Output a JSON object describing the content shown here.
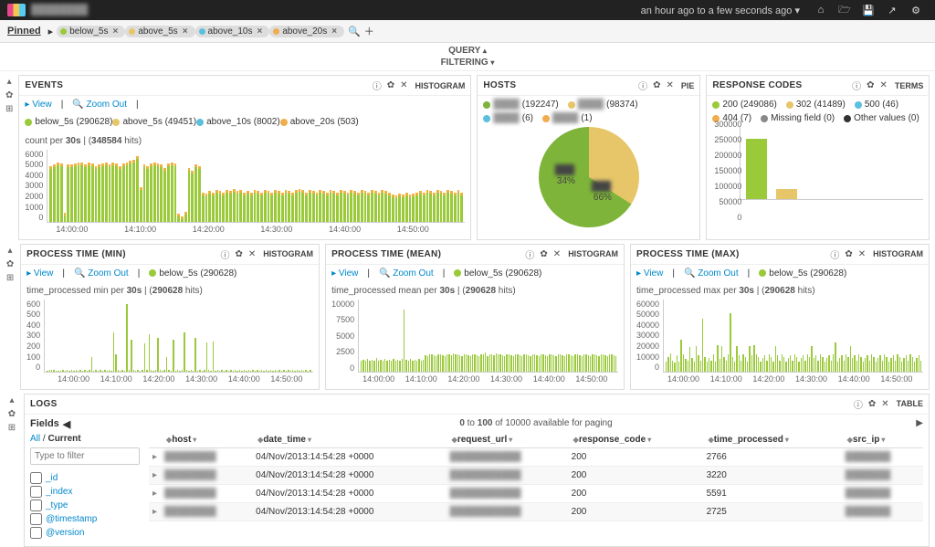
{
  "nav": {
    "timerange": "an hour ago to a few seconds ago",
    "timerange_caret": "▾"
  },
  "pinned": {
    "label": "Pinned",
    "search_icon_title": "search",
    "plus_icon_title": "add",
    "tags": [
      {
        "label": "below_5s",
        "color": "#9ac93a"
      },
      {
        "label": "above_5s",
        "color": "#e7c66a"
      },
      {
        "label": "above_10s",
        "color": "#5bc0de"
      },
      {
        "label": "above_20s",
        "color": "#f0ad4e"
      }
    ]
  },
  "qbar": {
    "query": "QUERY",
    "filtering": "FILTERING",
    "caret_up": "▴",
    "caret_down": "▾"
  },
  "row_icons": {
    "collapse": "▴",
    "gear": "✿",
    "add": "⊞"
  },
  "panel_events": {
    "title": "EVENTS",
    "type": "HISTOGRAM",
    "view": "View",
    "zoom": "Zoom Out",
    "legend": [
      {
        "label": "below_5s (290628)",
        "color": "#9ac93a"
      },
      {
        "label": "above_5s (49451)",
        "color": "#e7c66a"
      },
      {
        "label": "above_10s (8002)",
        "color": "#5bc0de"
      },
      {
        "label": "above_20s (503)",
        "color": "#f0ad4e"
      }
    ],
    "caption_a": "count per ",
    "caption_bold": "30s",
    "caption_b": " | (",
    "caption_c": "348584",
    "caption_d": " hits)"
  },
  "panel_hosts": {
    "title": "HOSTS",
    "type": "PIE",
    "items": [
      {
        "count": "(192247)",
        "color": "#7eb43a"
      },
      {
        "count": "(98374)",
        "color": "#e7c66a"
      },
      {
        "count": "(6)",
        "color": "#5bc0de"
      },
      {
        "count": "(1)",
        "color": "#f0ad4e"
      }
    ],
    "slice_a": "34%",
    "slice_b": "66%"
  },
  "panel_codes": {
    "title": "RESPONSE CODES",
    "type": "TERMS",
    "items": [
      {
        "label": "200 (249086)",
        "color": "#9ac93a"
      },
      {
        "label": "302 (41489)",
        "color": "#e7c66a"
      },
      {
        "label": "500 (46)",
        "color": "#5bc0de"
      },
      {
        "label": "404 (7)",
        "color": "#f0ad4e"
      },
      {
        "label": "Missing field (0)",
        "color": "#888"
      },
      {
        "label": "Other values (0)",
        "color": "#333"
      }
    ]
  },
  "panel_pt_min": {
    "title": "PROCESS TIME (MIN)",
    "type": "HISTOGRAM",
    "view": "View",
    "zoom": "Zoom Out",
    "legend_label": "below_5s (290628)",
    "legend_color": "#9ac93a",
    "caption_a": "time_processed min per ",
    "caption_bold": "30s",
    "caption_b": " | (",
    "caption_c": "290628",
    "caption_d": " hits)"
  },
  "panel_pt_mean": {
    "title": "PROCESS TIME (MEAN)",
    "type": "HISTOGRAM",
    "view": "View",
    "zoom": "Zoom Out",
    "legend_label": "below_5s (290628)",
    "legend_color": "#9ac93a",
    "caption_a": "time_processed mean per ",
    "caption_bold": "30s",
    "caption_b": " | (",
    "caption_c": "290628",
    "caption_d": " hits)"
  },
  "panel_pt_max": {
    "title": "PROCESS TIME (MAX)",
    "type": "HISTOGRAM",
    "view": "View",
    "zoom": "Zoom Out",
    "legend_label": "below_5s (290628)",
    "legend_color": "#9ac93a",
    "caption_a": "time_processed max per ",
    "caption_bold": "30s",
    "caption_b": " | (",
    "caption_c": "290628",
    "caption_d": " hits)"
  },
  "panel_logs": {
    "title": "LOGS",
    "type": "TABLE",
    "fields_title": "Fields",
    "all": "All",
    "current": "Current",
    "filter_ph": "Type to filter",
    "field_list": [
      "_id",
      "_index",
      "_type",
      "@timestamp",
      "@version"
    ],
    "pager_a": "0",
    "pager_b": " to ",
    "pager_c": "100",
    "pager_d": " of 10000 available for paging",
    "cols": [
      "host",
      "date_time",
      "request_url",
      "response_code",
      "time_processed",
      "src_ip"
    ],
    "rows": [
      {
        "date_time": "04/Nov/2013:14:54:28 +0000",
        "response_code": "200",
        "time_processed": "2766"
      },
      {
        "date_time": "04/Nov/2013:14:54:28 +0000",
        "response_code": "200",
        "time_processed": "3220"
      },
      {
        "date_time": "04/Nov/2013:14:54:28 +0000",
        "response_code": "200",
        "time_processed": "5591"
      },
      {
        "date_time": "04/Nov/2013:14:54:28 +0000",
        "response_code": "200",
        "time_processed": "2725"
      }
    ]
  },
  "chart_data": [
    {
      "id": "events",
      "type": "bar",
      "title": "EVENTS — count per 30s (348584 hits)",
      "ylim": [
        0,
        6000
      ],
      "yticks": [
        0,
        1000,
        2000,
        3000,
        4000,
        5000,
        6000
      ],
      "xticks": [
        "14:00:00",
        "14:10:00",
        "14:20:00",
        "14:30:00",
        "14:40:00",
        "14:50:00"
      ],
      "series_colors": {
        "below_5s": "#9ac93a",
        "above_5s": "#e7c66a",
        "above_10s": "#5bc0de",
        "above_20s": "#f0ad4e"
      },
      "stacked_total_estimate": [
        4400,
        4500,
        4700,
        4600,
        500,
        4500,
        4500,
        4600,
        4700,
        4700,
        4500,
        4700,
        4600,
        4400,
        4500,
        4600,
        4700,
        4500,
        4700,
        4600,
        4400,
        4600,
        4700,
        4800,
        4900,
        5200,
        2600,
        4500,
        4400,
        4600,
        4700,
        4600,
        4500,
        4200,
        4600,
        4700,
        4600,
        400,
        200,
        600,
        4200,
        4000,
        4500,
        4400,
        2200,
        2100,
        2300,
        2200,
        2400,
        2300,
        2200,
        2400,
        2300,
        2500,
        2300,
        2400,
        2200,
        2300,
        2200,
        2400,
        2300,
        2200,
        2400,
        2300,
        2200,
        2400,
        2300,
        2200,
        2400,
        2300,
        2200,
        2400,
        2500,
        2400,
        2200,
        2400,
        2300,
        2200,
        2400,
        2300,
        2200,
        2400,
        2300,
        2200,
        2400,
        2300,
        2200,
        2400,
        2300,
        2200,
        2400,
        2300,
        2200,
        2400,
        2300,
        2200,
        2400,
        2300,
        2200,
        2000,
        1900,
        2100,
        2000,
        2200,
        2000,
        2100,
        2200,
        2300,
        2200,
        2400,
        2300,
        2200,
        2400,
        2300,
        2200,
        2400,
        2300,
        2200,
        2400,
        2200
      ]
    },
    {
      "id": "hosts",
      "type": "pie",
      "title": "HOSTS",
      "slices": [
        {
          "label": "host-a",
          "value": 192247,
          "pct": 66,
          "color": "#7eb43a"
        },
        {
          "label": "host-b",
          "value": 98374,
          "pct": 34,
          "color": "#e7c66a"
        },
        {
          "label": "host-c",
          "value": 6,
          "pct": 0,
          "color": "#5bc0de"
        },
        {
          "label": "host-d",
          "value": 1,
          "pct": 0,
          "color": "#f0ad4e"
        }
      ]
    },
    {
      "id": "response_codes",
      "type": "bar",
      "title": "RESPONSE CODES",
      "ylim": [
        0,
        300000
      ],
      "yticks": [
        0,
        50000,
        100000,
        150000,
        200000,
        250000,
        300000
      ],
      "categories": [
        "200",
        "302",
        "500",
        "404",
        "Missing field",
        "Other values"
      ],
      "values": [
        249086,
        41489,
        46,
        7,
        0,
        0
      ],
      "colors": [
        "#9ac93a",
        "#e7c66a",
        "#5bc0de",
        "#f0ad4e",
        "#888",
        "#333"
      ]
    },
    {
      "id": "process_time_min",
      "type": "bar",
      "title": "PROCESS TIME (MIN) — time_processed min per 30s (290628 hits)",
      "ylim": [
        0,
        600
      ],
      "yticks": [
        0,
        100,
        200,
        300,
        400,
        500,
        600
      ],
      "xticks": [
        "14:00:00",
        "14:10:00",
        "14:20:00",
        "14:30:00",
        "14:40:00",
        "14:50:00"
      ],
      "values_estimate": [
        5,
        10,
        8,
        12,
        5,
        6,
        7,
        9,
        5,
        10,
        6,
        8,
        5,
        12,
        7,
        9,
        5,
        11,
        6,
        8,
        120,
        5,
        9,
        6,
        8,
        5,
        11,
        7,
        9,
        5,
        320,
        140,
        12,
        6,
        8,
        5,
        560,
        11,
        260,
        9,
        5,
        10,
        6,
        8,
        230,
        12,
        310,
        9,
        5,
        10,
        280,
        8,
        5,
        12,
        120,
        9,
        5,
        260,
        6,
        8,
        5,
        12,
        320,
        9,
        5,
        10,
        6,
        280,
        5,
        12,
        7,
        9,
        240,
        10,
        6,
        250,
        5,
        12,
        7,
        9,
        5,
        10,
        6,
        8,
        5,
        12,
        7,
        9,
        5,
        10,
        6,
        8,
        5,
        12,
        7,
        9,
        5,
        10,
        6,
        8,
        5,
        12,
        7,
        9,
        5,
        10,
        6,
        8,
        5,
        12,
        7,
        9,
        5,
        10,
        6,
        8,
        5,
        12,
        7,
        9
      ]
    },
    {
      "id": "process_time_mean",
      "type": "bar",
      "title": "PROCESS TIME (MEAN) — time_processed mean per 30s (290628 hits)",
      "ylim": [
        0,
        10000
      ],
      "yticks": [
        0,
        2500,
        5000,
        7500,
        10000
      ],
      "xticks": [
        "14:00:00",
        "14:10:00",
        "14:20:00",
        "14:30:00",
        "14:40:00",
        "14:50:00"
      ],
      "values_estimate": [
        1500,
        1600,
        1400,
        1700,
        1500,
        1600,
        1400,
        1800,
        1500,
        1600,
        1400,
        1700,
        1500,
        1600,
        1400,
        1700,
        1500,
        1600,
        1400,
        1700,
        8500,
        1600,
        1400,
        1700,
        1500,
        1600,
        1400,
        1700,
        1500,
        1600,
        2200,
        2100,
        2300,
        2400,
        2200,
        2100,
        2300,
        2400,
        2200,
        2100,
        2300,
        2400,
        2200,
        2500,
        2300,
        2400,
        2200,
        2100,
        2300,
        2400,
        2200,
        2100,
        2300,
        2400,
        2200,
        2100,
        2300,
        2400,
        2600,
        2100,
        2300,
        2400,
        2200,
        2500,
        2300,
        2400,
        2200,
        2100,
        2300,
        2400,
        2200,
        2100,
        2300,
        2400,
        2200,
        2100,
        2300,
        2400,
        2200,
        2100,
        2300,
        2400,
        2200,
        2100,
        2300,
        2400,
        2200,
        2100,
        2300,
        2400,
        2200,
        2100,
        2300,
        2400,
        2200,
        2100,
        2300,
        2400,
        2200,
        2100,
        2300,
        2400,
        2200,
        2100,
        2300,
        2400,
        2200,
        2100,
        2300,
        2400,
        2200,
        2100,
        2300,
        2400,
        2200,
        2100,
        2300,
        2400,
        2200,
        2100
      ]
    },
    {
      "id": "process_time_max",
      "type": "bar",
      "title": "PROCESS TIME (MAX) — time_processed max per 30s (290628 hits)",
      "ylim": [
        0,
        60000
      ],
      "yticks": [
        0,
        10000,
        20000,
        30000,
        40000,
        50000,
        60000
      ],
      "xticks": [
        "14:00:00",
        "14:10:00",
        "14:20:00",
        "14:30:00",
        "14:40:00",
        "14:50:00"
      ],
      "values_estimate": [
        8000,
        12000,
        15000,
        9000,
        7000,
        13000,
        8000,
        26000,
        14000,
        10000,
        9000,
        20000,
        11000,
        8000,
        21000,
        13000,
        9000,
        44000,
        12000,
        8000,
        11000,
        9000,
        14000,
        8000,
        22000,
        10000,
        21000,
        12000,
        9000,
        14000,
        48000,
        12000,
        8000,
        21000,
        13000,
        9000,
        14000,
        12000,
        8000,
        21000,
        13000,
        22000,
        14000,
        12000,
        8000,
        11000,
        13000,
        9000,
        14000,
        12000,
        8000,
        21000,
        13000,
        9000,
        14000,
        12000,
        8000,
        11000,
        13000,
        9000,
        14000,
        12000,
        8000,
        11000,
        13000,
        9000,
        14000,
        12000,
        21000,
        11000,
        13000,
        9000,
        14000,
        12000,
        8000,
        11000,
        13000,
        9000,
        14000,
        24000,
        8000,
        11000,
        13000,
        9000,
        14000,
        12000,
        21000,
        11000,
        13000,
        9000,
        14000,
        12000,
        8000,
        11000,
        13000,
        9000,
        14000,
        12000,
        8000,
        11000,
        13000,
        9000,
        14000,
        12000,
        8000,
        11000,
        13000,
        9000,
        14000,
        12000,
        8000,
        11000,
        13000,
        9000,
        14000,
        12000,
        8000,
        11000,
        13000,
        9000
      ]
    }
  ]
}
